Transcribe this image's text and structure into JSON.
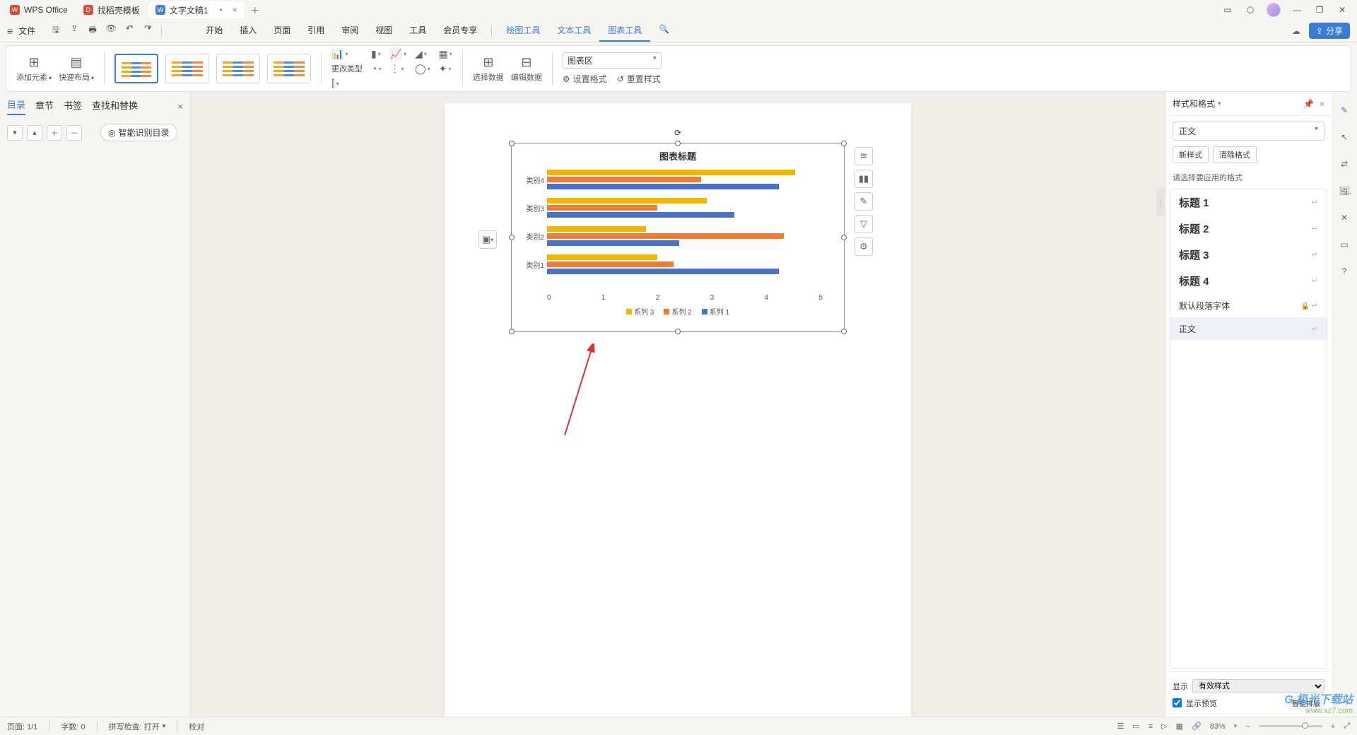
{
  "titlebar": {
    "tabs": [
      {
        "label": "WPS Office",
        "icon": "W"
      },
      {
        "label": "找稻壳模板",
        "icon": "D"
      },
      {
        "label": "文字文稿1",
        "icon": "W"
      }
    ]
  },
  "menubar": {
    "file": "文件",
    "tabs": [
      "开始",
      "插入",
      "页面",
      "引用",
      "审阅",
      "视图",
      "工具",
      "会员专享"
    ],
    "context_tabs": [
      "绘图工具",
      "文本工具",
      "图表工具"
    ],
    "share": "分享"
  },
  "ribbon": {
    "add_element": "添加元素",
    "quick_layout": "快速布局",
    "change_type": "更改类型",
    "select_data": "选择数据",
    "edit_data": "编辑数据",
    "chart_area_select": "图表区",
    "set_format": "设置格式",
    "reset_style": "重置样式"
  },
  "left_panel": {
    "tabs": [
      "目录",
      "章节",
      "书签",
      "查找和替换"
    ],
    "smart_toc": "智能识别目录"
  },
  "chart_data": {
    "type": "bar",
    "title": "图表标题",
    "orientation": "horizontal",
    "categories": [
      "类别4",
      "类别3",
      "类别2",
      "类别1"
    ],
    "series": [
      {
        "name": "系列 3",
        "values": [
          4.5,
          2.9,
          1.8,
          2.0
        ],
        "color": "#f5b400"
      },
      {
        "name": "系列 2",
        "values": [
          2.8,
          2.0,
          4.3,
          2.3
        ],
        "color": "#ed7d31"
      },
      {
        "name": "系列 1",
        "values": [
          4.2,
          3.4,
          2.4,
          4.2
        ],
        "color": "#4a72c8"
      }
    ],
    "x_ticks": [
      0,
      1,
      2,
      3,
      4,
      5
    ],
    "xlim": [
      0,
      5
    ],
    "xlabel": "",
    "ylabel": "",
    "legend_position": "bottom"
  },
  "right_panel": {
    "title": "样式和格式",
    "current_style": "正文",
    "new_style": "新样式",
    "clear_format": "清除格式",
    "hint": "请选择要应用的格式",
    "styles": [
      {
        "label": "标题 1"
      },
      {
        "label": "标题 2"
      },
      {
        "label": "标题 3"
      },
      {
        "label": "标题 4"
      },
      {
        "label": "默认段落字体",
        "lock": true
      },
      {
        "label": "正文",
        "selected": true
      }
    ],
    "display_label": "显示",
    "display_value": "有效样式",
    "preview_check": "显示预览",
    "smart_layout": "智能排版"
  },
  "statusbar": {
    "page": "页面: 1/1",
    "words": "字数: 0",
    "spell": "拼写检查: 打开",
    "proof": "校对",
    "zoom": "83%"
  },
  "watermark": {
    "brand": "极光下载站",
    "url": "www.xz7.com"
  }
}
